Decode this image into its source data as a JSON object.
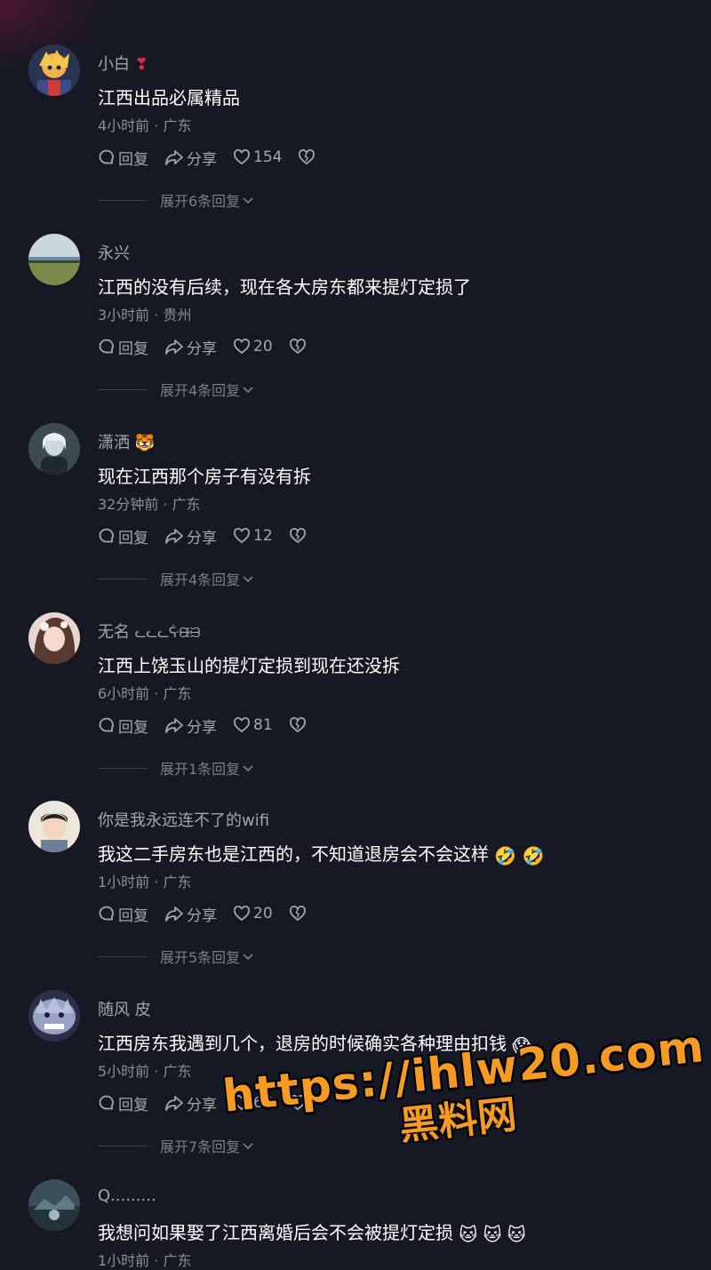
{
  "labels": {
    "reply": "回复",
    "share": "分享"
  },
  "comments": [
    {
      "username": "小白",
      "username_emoji": "❣",
      "text": "江西出品必属精品",
      "meta": "4小时前 · 广东",
      "likes": "154",
      "expand": "展开6条回复"
    },
    {
      "username": "永兴",
      "text": "江西的没有后续，现在各大房东都来提灯定损了",
      "meta": "3小时前 · 贵州",
      "likes": "20",
      "expand": "展开4条回复"
    },
    {
      "username": "潇洒",
      "username_emoji": "🐯",
      "text": "现在江西那个房子有没有拆",
      "meta": "32分钟前 · 广东",
      "likes": "12",
      "expand": "展开4条回复"
    },
    {
      "username": "无名",
      "username_suffix": "ᓚᓚᓚᕏᙠᙣ",
      "text": "江西上饶玉山的提灯定损到现在还没拆",
      "meta": "6小时前 · 广东",
      "likes": "81",
      "expand": "展开1条回复"
    },
    {
      "username": "你是我永远连不了的wifi",
      "text": "我这二手房东也是江西的，不知道退房会不会这样",
      "text_emoji": [
        "🤣",
        "🤣"
      ],
      "meta": "1小时前 · 广东",
      "likes": "20",
      "expand": "展开5条回复"
    },
    {
      "username": "随风 皮",
      "text": "江西房东我遇到几个，退房的时候确实各种理由扣钱",
      "text_emoji": [
        "😱"
      ],
      "meta": "5小时前 · 广东",
      "likes": "66",
      "expand": "展开7条回复"
    },
    {
      "username": "Q.........",
      "text": "我想问如果娶了江西离婚后会不会被提灯定损",
      "text_emoji": [
        "🐱",
        "🐱",
        "🐱"
      ],
      "meta": "1小时前 · 广东"
    }
  ],
  "watermark": {
    "url": "https://ihlw20.com",
    "name": "黑料网"
  },
  "colors": {
    "background": "#161823",
    "text_primary": "#ffffff",
    "text_secondary": "#a4a6ad",
    "watermark": "#f59a23"
  }
}
